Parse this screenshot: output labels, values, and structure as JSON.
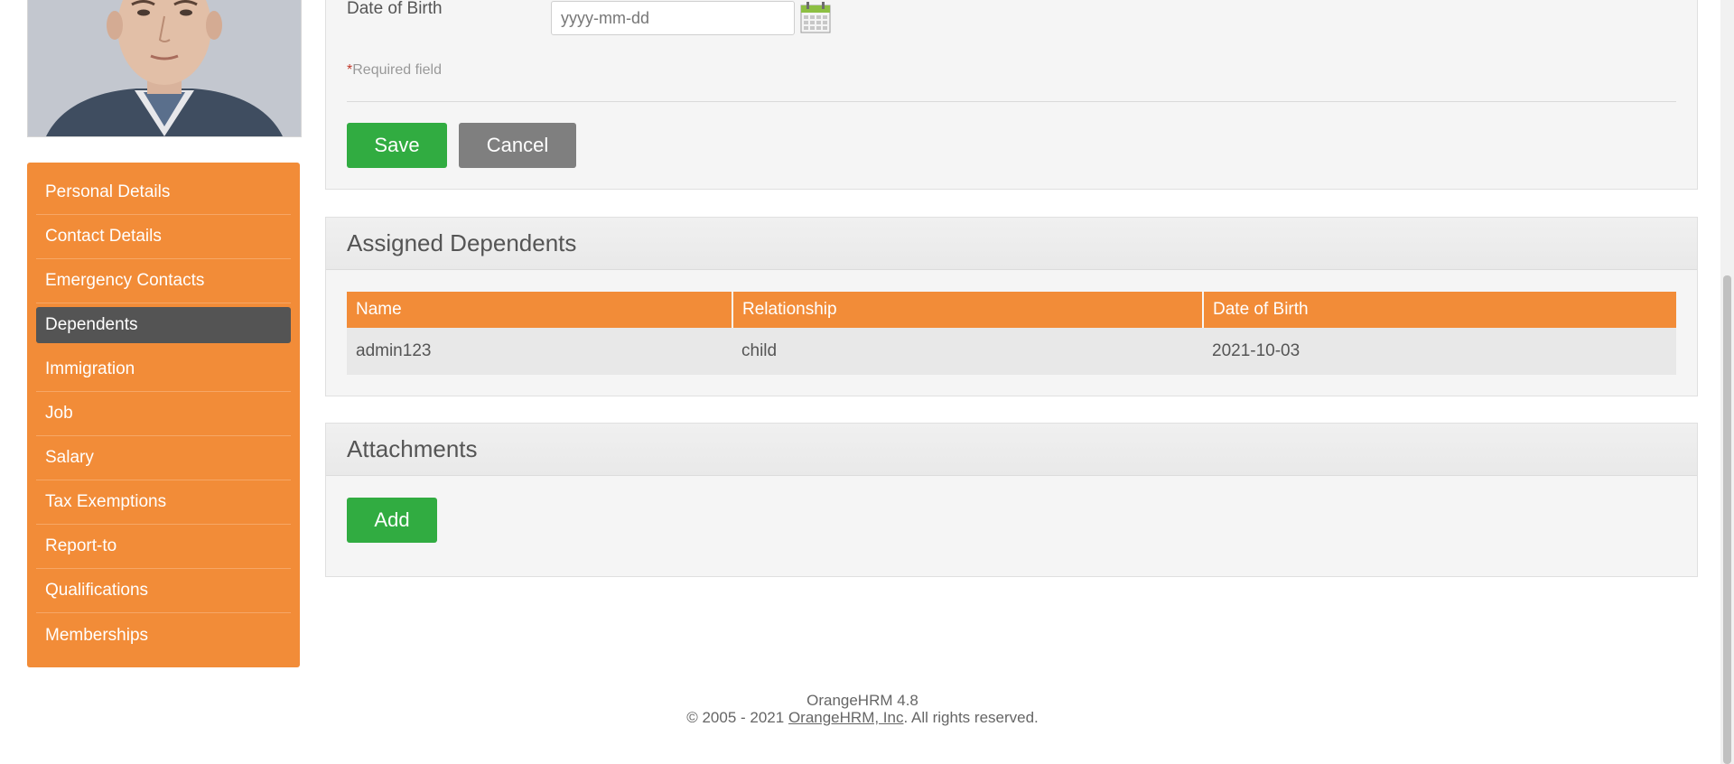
{
  "employee_photo": {
    "alt": "employee-photo"
  },
  "sidebar": {
    "items": [
      {
        "label": "Personal Details"
      },
      {
        "label": "Contact Details"
      },
      {
        "label": "Emergency Contacts"
      },
      {
        "label": "Dependents"
      },
      {
        "label": "Immigration"
      },
      {
        "label": "Job"
      },
      {
        "label": "Salary"
      },
      {
        "label": "Tax Exemptions"
      },
      {
        "label": "Report-to"
      },
      {
        "label": "Qualifications"
      },
      {
        "label": "Memberships"
      }
    ],
    "active": "Dependents"
  },
  "form": {
    "dob_label": "Date of Birth",
    "dob_placeholder": "yyyy-mm-dd",
    "dob_value": "",
    "required_star": "*",
    "required_text": "Required field",
    "save_label": "Save",
    "cancel_label": "Cancel"
  },
  "dependents": {
    "title": "Assigned Dependents",
    "columns": [
      "Name",
      "Relationship",
      "Date of Birth"
    ],
    "rows": [
      [
        "admin123",
        "child",
        "2021-10-03"
      ]
    ]
  },
  "attachments": {
    "title": "Attachments",
    "add_label": "Add"
  },
  "footer": {
    "version": "OrangeHRM 4.8",
    "copyright_prefix": "© 2005 - 2021 ",
    "company_link": "OrangeHRM, Inc",
    "copyright_suffix": ". All rights reserved."
  },
  "colors": {
    "accent_orange": "#f28c38",
    "button_green": "#31ac41",
    "button_grey": "#7f7f7f",
    "active_nav": "#545454"
  },
  "icons": {
    "calendar": "calendar-icon"
  }
}
